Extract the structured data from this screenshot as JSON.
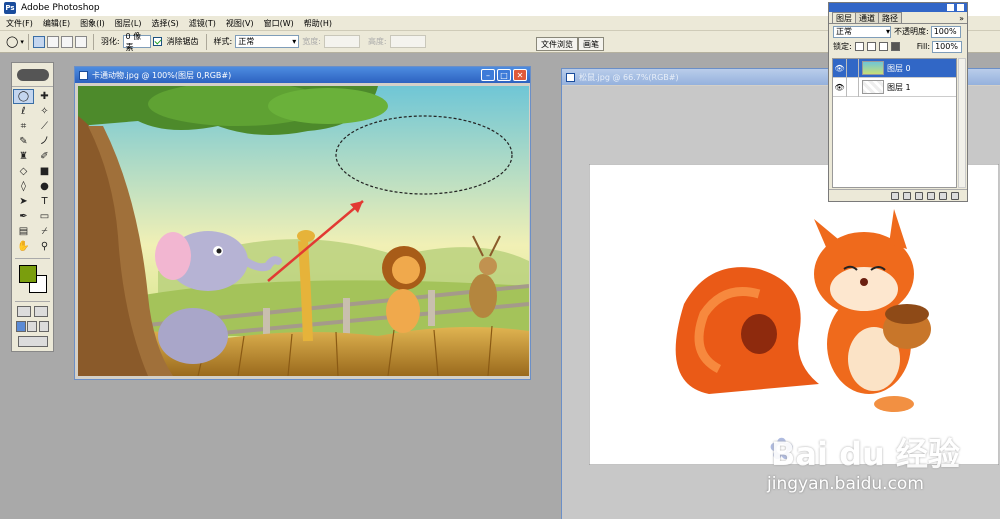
{
  "app": {
    "title": "Adobe Photoshop"
  },
  "menu": [
    "文件(F)",
    "编辑(E)",
    "图象(I)",
    "图层(L)",
    "选择(S)",
    "滤镜(T)",
    "视图(V)",
    "窗口(W)",
    "帮助(H)"
  ],
  "options": {
    "feather_label": "羽化:",
    "feather_value": "0 像素",
    "antialias_label": "消除锯齿",
    "style_label": "样式:",
    "style_value": "正常",
    "width_label": "宽度:",
    "height_label": "高度:",
    "file_browser_tab": "文件浏览",
    "brushes_tab": "画笔"
  },
  "doc1": {
    "title": "卡通动物.jpg @ 100%(图层 0,RGB#)"
  },
  "doc2": {
    "title": "松鼠.jpg @ 66.7%(RGB#)"
  },
  "layers_panel": {
    "tabs": [
      "图层",
      "通道",
      "路径"
    ],
    "blend_mode": "正常",
    "opacity_label": "不透明度:",
    "opacity_value": "100%",
    "lock_label": "锁定:",
    "fill_label": "Fill:",
    "fill_value": "100%",
    "layers": [
      {
        "name": "图层 0",
        "selected": true
      },
      {
        "name": "图层 1",
        "selected": false
      }
    ]
  },
  "watermark": {
    "brand": "Bai du 经验",
    "url": "jingyan.baidu.com"
  },
  "colors": {
    "foreground": "#7a9e0d",
    "background": "#ffffff",
    "title_active": "#2d62c0"
  }
}
